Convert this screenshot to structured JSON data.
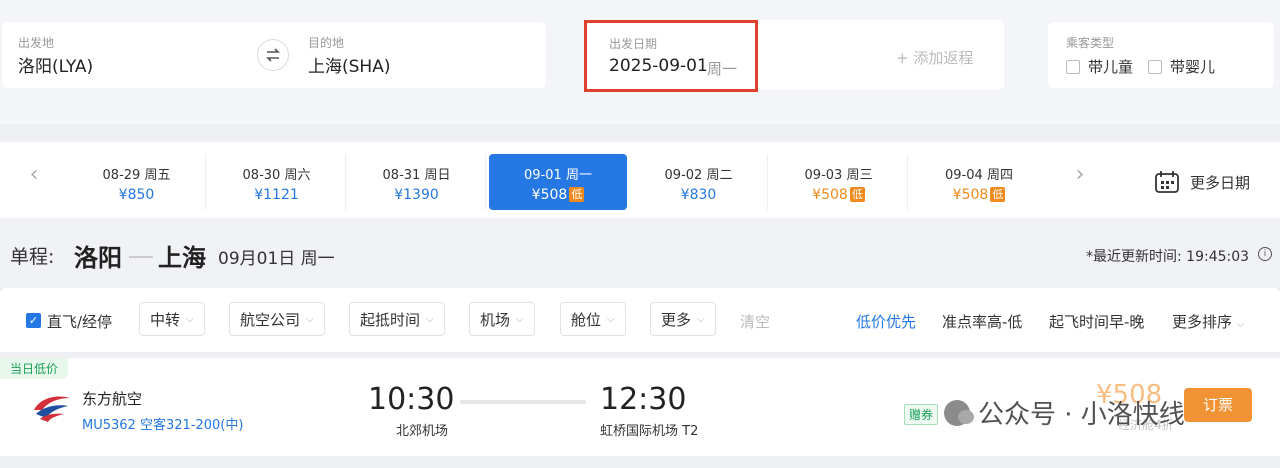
{
  "search": {
    "from_label": "出发地",
    "from_value": "洛阳(LYA)",
    "to_label": "目的地",
    "to_value": "上海(SHA)",
    "date_label": "出发日期",
    "date_value": "2025-09-01",
    "date_weekday": "周一",
    "add_return": "+ 添加返程",
    "pax_label": "乘客类型",
    "pax_child": "带儿童",
    "pax_infant": "带婴儿"
  },
  "date_strip": {
    "more_dates": "更多日期",
    "cells": [
      {
        "label": "08-29  周五",
        "price": "¥850"
      },
      {
        "label": "08-30  周六",
        "price": "¥1121"
      },
      {
        "label": "08-31  周日",
        "price": "¥1390"
      },
      {
        "label": "09-01  周一",
        "price": "¥508",
        "badge": "低"
      },
      {
        "label": "09-02  周二",
        "price": "¥830"
      },
      {
        "label": "09-03  周三",
        "price": "¥508",
        "badge": "低"
      },
      {
        "label": "09-04  周四",
        "price": "¥508",
        "badge": "低"
      }
    ]
  },
  "itinerary": {
    "trip_type": "单程:",
    "city_from": "洛阳",
    "city_to": "上海",
    "date": "09月01日 周一",
    "update_time": "*最近更新时间: 19:45:03"
  },
  "filters": {
    "direct": "直飞/经停",
    "transfer": "中转",
    "airline": "航空公司",
    "time": "起抵时间",
    "airport": "机场",
    "cabin": "舱位",
    "more": "更多",
    "clear": "清空",
    "sort_low_price": "低价优先",
    "sort_punctuality": "准点率高-低",
    "sort_departure": "起飞时间早-晚",
    "sort_more": "更多排序"
  },
  "flight": {
    "tag": "当日低价",
    "airline": "东方航空",
    "flight_no": "MU5362 空客321-200(中)",
    "dep_time": "10:30",
    "dep_airport": "北郊机场",
    "arr_time": "12:30",
    "arr_airport": "虹桥国际机场 T2",
    "promo": "赠券",
    "price": "¥508",
    "discount": "经济舱4折",
    "book": "订票"
  },
  "watermark": "公众号 · 小洛快线",
  "colors": {
    "accent": "#2577e3",
    "low_price": "#f08a1d",
    "highlight_border": "#e0402d",
    "green_tag": "#19a05a"
  }
}
